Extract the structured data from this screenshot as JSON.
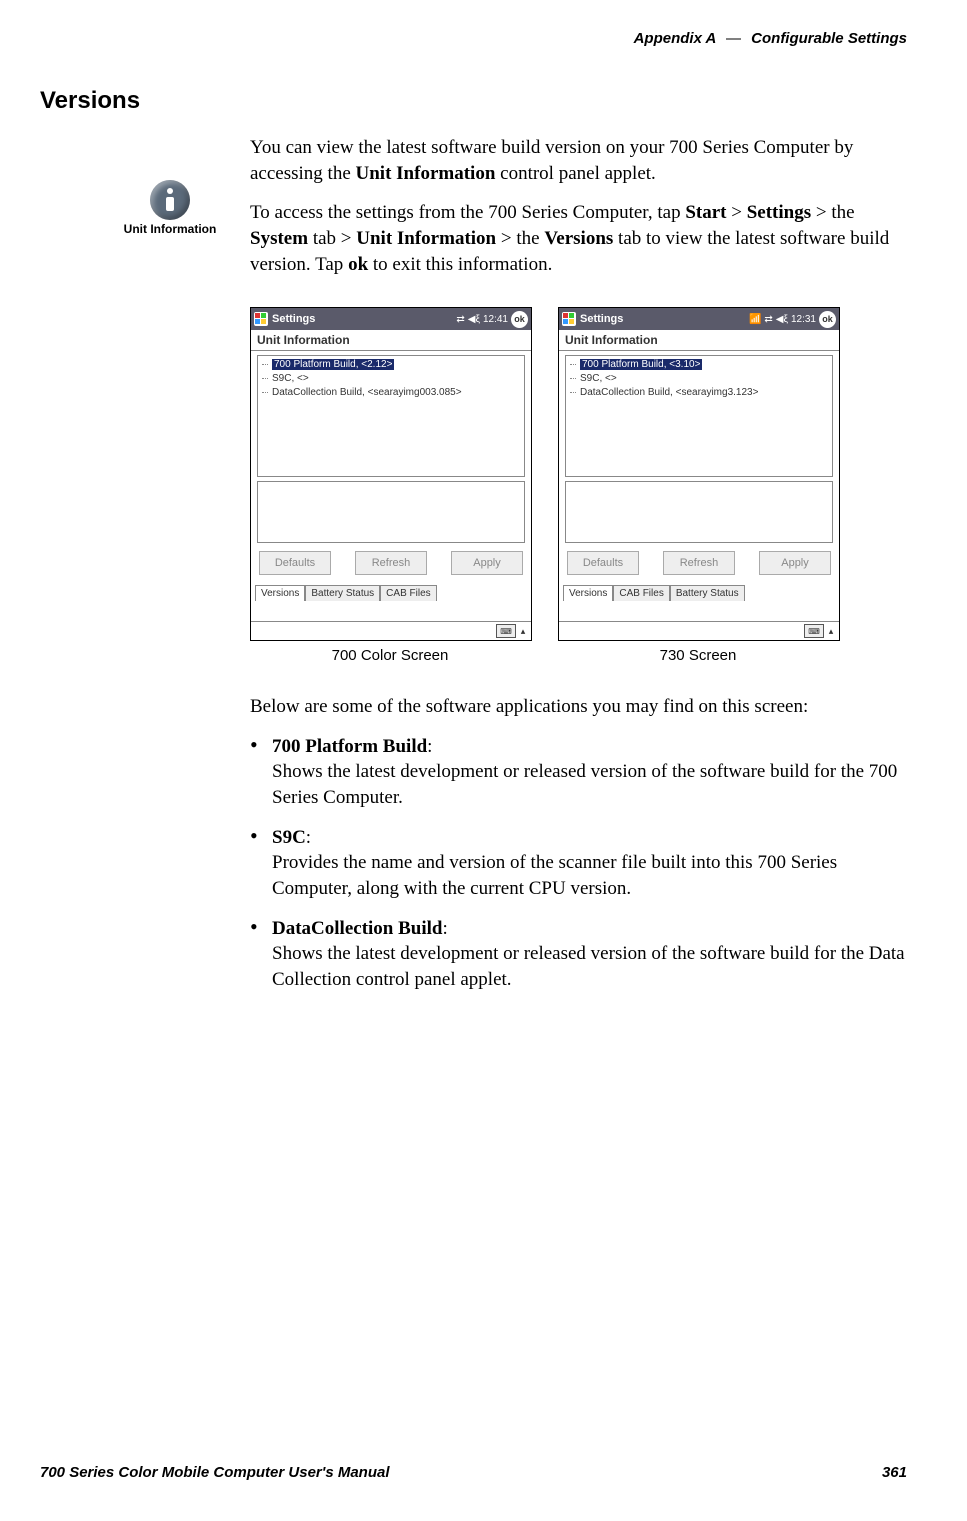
{
  "header": {
    "appendix": "Appendix A",
    "sep": "—",
    "title": "Configurable Settings"
  },
  "section_title": "Versions",
  "intro_p1_a": "You can view the latest software build version on your 700 Series Computer by accessing the ",
  "intro_p1_b": "Unit Information",
  "intro_p1_c": " control panel applet.",
  "access_p_a": "To access the settings from the 700 Series Computer, tap ",
  "access_kw": {
    "start": "Start",
    "settings": "Settings",
    "system": "System",
    "unitinfo": "Unit Information",
    "versions": "Versions",
    "ok": "ok"
  },
  "access_gt": " > ",
  "access_the": " > the ",
  "access_tab": " tab > ",
  "access_p_b": " tab to view the latest software build version. Tap ",
  "access_p_c": " to exit this information.",
  "icon_label": "Unit Information",
  "screens": {
    "left": {
      "title": "Settings",
      "time": "12:41",
      "panel": "Unit Information",
      "tree": [
        "700 Platform Build, <2.12>",
        "S9C, <>",
        "DataCollection Build, <searayimg003.085>"
      ],
      "buttons": [
        "Defaults",
        "Refresh",
        "Apply"
      ],
      "tabs": [
        "Versions",
        "Battery Status",
        "CAB Files"
      ],
      "caption": "700 Color Screen"
    },
    "right": {
      "title": "Settings",
      "time": "12:31",
      "panel": "Unit Information",
      "tree": [
        "700 Platform Build, <3.10>",
        "S9C, <>",
        "DataCollection Build, <searayimg3.123>"
      ],
      "buttons": [
        "Defaults",
        "Refresh",
        "Apply"
      ],
      "tabs": [
        "Versions",
        "CAB Files",
        "Battery Status"
      ],
      "caption": "730 Screen"
    }
  },
  "below_intro": "Below are some of the software applications you may find on this screen:",
  "defs": [
    {
      "term": "700 Platform Build",
      "desc": "Shows the latest development or released version of the software build for the 700 Series Computer."
    },
    {
      "term": "S9C",
      "desc": "Provides the name and version of the scanner file built into this 700 Series Computer, along with the current CPU version."
    },
    {
      "term": "DataCollection Build",
      "desc": "Shows the latest development or released version of the software build for the Data Collection control panel applet."
    }
  ],
  "footer": {
    "left": "700 Series Color Mobile Computer User's Manual",
    "right": "361"
  },
  "ok_label": "ok"
}
